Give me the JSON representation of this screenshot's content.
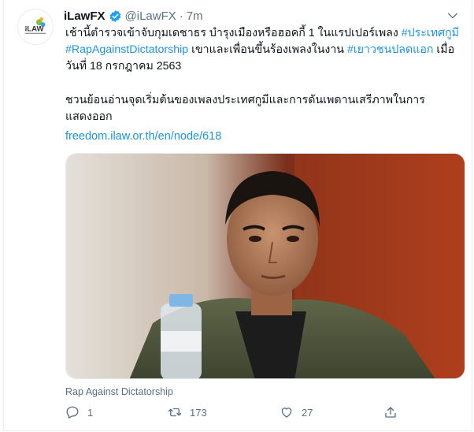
{
  "tweet": {
    "author_name": "iLawFX",
    "handle": "@iLawFX",
    "separator": "·",
    "time": "7m",
    "avatar_icon": "ilaw-logo",
    "avatar_text": "iLAW",
    "text_line_1": "เช้านี้ตำรวจเข้าจับกุมเดชาธร บำรุงเมืองหรือฮอคกี้ 1 ในแรปเปอร์เพลง ",
    "hashtag_1": "#ประเทศกูมี",
    "hashtag_2": "#RapAgainstDictatorship",
    "text_line_2": " เขาและเพื่อนขึ้นร้องเพลงในงาน ",
    "hashtag_3": "#เยาวชนปลดแอก",
    "text_line_3": " เมื่อวันที่ 18 กรกฎาคม 2563",
    "text_para_2": "ชวนย้อนอ่านจุดเริ่มต้นของเพลงประเทศกูมีและการดันเพดานเสรีภาพในการแสดงออก",
    "url": "freedom.ilaw.or.th/en/node/618",
    "media_caption": "Rap Against Dictatorship",
    "replies": "1",
    "retweets": "173",
    "likes": "27"
  },
  "colors": {
    "link": "#1b95e0",
    "verified": "#1da1f2",
    "secondary_text": "#5b7083"
  }
}
